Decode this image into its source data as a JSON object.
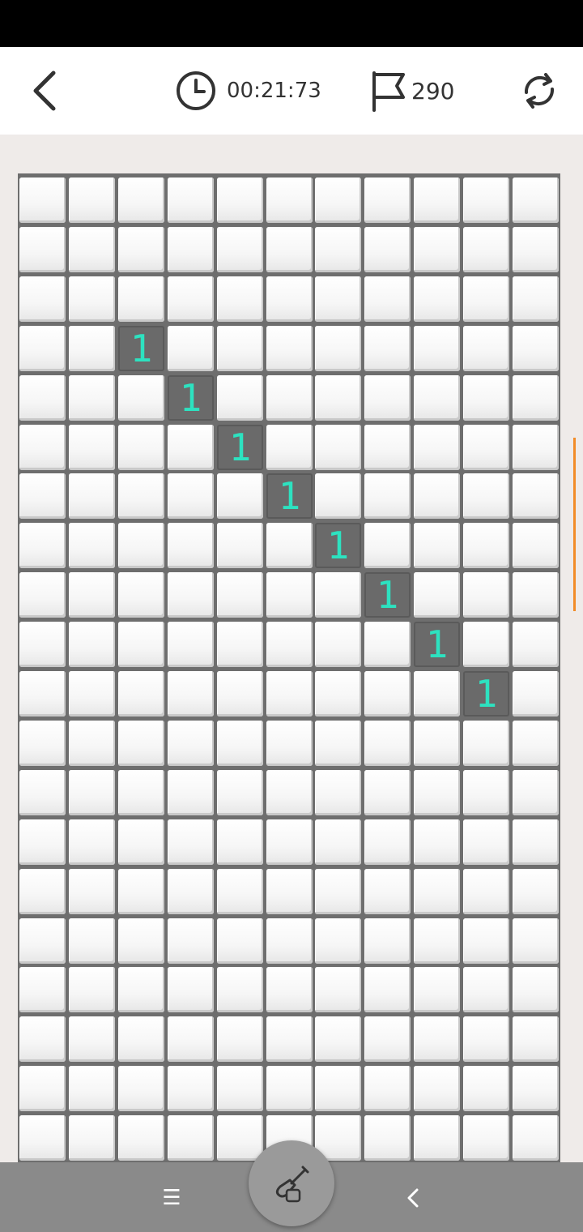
{
  "header": {
    "timer": "00:21:73",
    "flags": "290"
  },
  "icons": {
    "back": "chevron-left-icon",
    "timer": "clock-icon",
    "flag": "flag-icon",
    "restart": "refresh-icon",
    "dig_mode": "shovel-icon",
    "nav_menu": "menu-icon",
    "nav_back": "chevron-left-icon"
  },
  "board": {
    "columns": 11,
    "visible_rows": 20,
    "revealed": [
      {
        "row": 3,
        "col": 2,
        "value": "1"
      },
      {
        "row": 4,
        "col": 3,
        "value": "1"
      },
      {
        "row": 5,
        "col": 4,
        "value": "1"
      },
      {
        "row": 6,
        "col": 5,
        "value": "1"
      },
      {
        "row": 7,
        "col": 6,
        "value": "1"
      },
      {
        "row": 8,
        "col": 7,
        "value": "1"
      },
      {
        "row": 9,
        "col": 8,
        "value": "1"
      },
      {
        "row": 10,
        "col": 9,
        "value": "1"
      }
    ]
  },
  "colors": {
    "number": "#2de2c0",
    "revealed_cell": "#6a6a6a",
    "scroll_indicator": "#f28c28",
    "nav_bar": "#8a8a8a"
  },
  "nav": {
    "menu_glyph": "☰"
  }
}
